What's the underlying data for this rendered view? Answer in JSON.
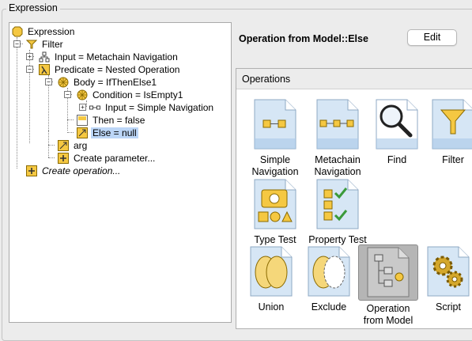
{
  "group_title": "Expression",
  "tree": {
    "items": [
      {
        "label": "Expression"
      },
      {
        "label": "Filter"
      },
      {
        "label": "Input = Metachain Navigation"
      },
      {
        "label": "Predicate = Nested Operation"
      },
      {
        "label": "Body = IfThenElse1"
      },
      {
        "label": "Condition = IsEmpty1"
      },
      {
        "label": "Input = Simple Navigation"
      },
      {
        "label": "Then = false"
      },
      {
        "label": "Else = null"
      },
      {
        "label": "arg"
      },
      {
        "label": "Create parameter..."
      },
      {
        "label": "Create operation..."
      }
    ]
  },
  "details": {
    "title": "Operation from Model::Else",
    "edit_label": "Edit"
  },
  "operations": {
    "title": "Operations",
    "items": [
      {
        "label": "Simple Navigation",
        "icon": "simple-navigation-icon"
      },
      {
        "label": "Metachain Navigation",
        "icon": "metachain-navigation-icon"
      },
      {
        "label": "Find",
        "icon": "magnifier-icon"
      },
      {
        "label": "Filter",
        "icon": "funnel-icon"
      },
      {
        "label": "Type Test",
        "icon": "type-test-icon"
      },
      {
        "label": "Property Test",
        "icon": "property-test-icon"
      },
      {
        "label": "Union",
        "icon": "union-icon"
      },
      {
        "label": "Exclude",
        "icon": "exclude-icon"
      },
      {
        "label": "Operation from Model",
        "icon": "operation-from-model-icon",
        "selected": true
      },
      {
        "label": "Script",
        "icon": "gears-icon"
      }
    ]
  },
  "colors": {
    "selection": "#bcd6f7",
    "icon_yellow": "#f5c842",
    "doc_blue": "#cfe2f3"
  }
}
